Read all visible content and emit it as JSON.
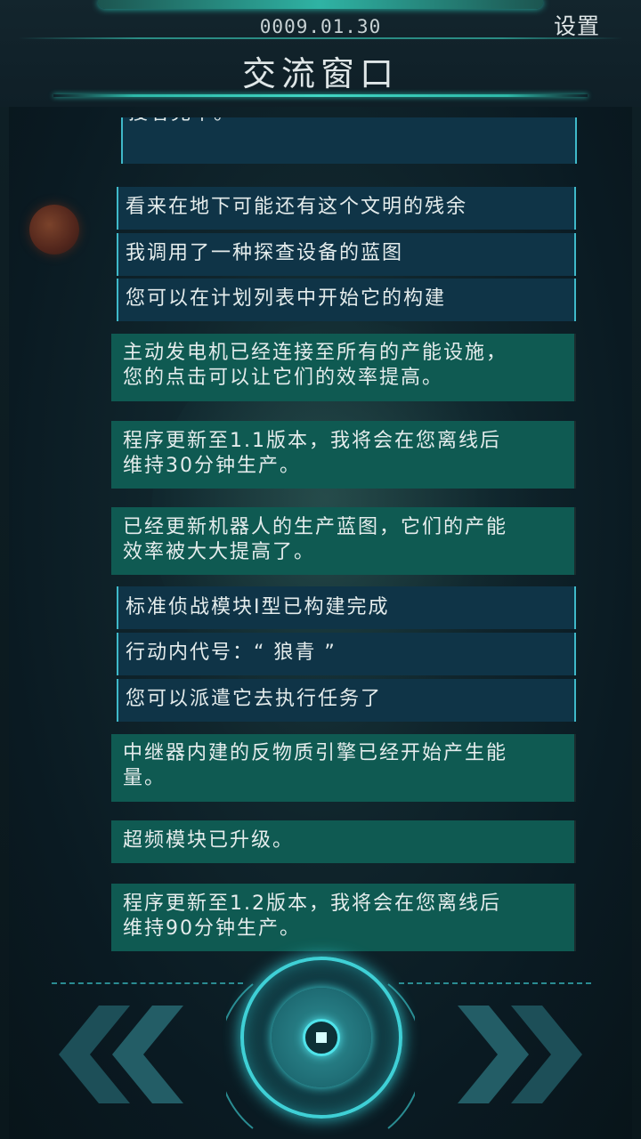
{
  "header": {
    "date": "0009.01.30",
    "settings_label": "设置",
    "title": "交流窗口"
  },
  "messages": [
    {
      "style": "blue",
      "lines": [
        "搜者完毕。"
      ]
    },
    {
      "style": "blue",
      "lines": [
        "看来在地下可能还有这个文明的残余"
      ]
    },
    {
      "style": "blue",
      "lines": [
        "我调用了一种探查设备的蓝图"
      ]
    },
    {
      "style": "blue",
      "lines": [
        "您可以在计划列表中开始它的构建"
      ]
    },
    {
      "style": "green",
      "lines": [
        "主动发电机已经连接至所有的产能设施，",
        "您的点击可以让它们的效率提高。"
      ]
    },
    {
      "style": "green",
      "lines": [
        "程序更新至1.1版本，我将会在您离线后",
        "维持30分钟生产。"
      ]
    },
    {
      "style": "green",
      "lines": [
        "已经更新机器人的生产蓝图，它们的产能",
        "效率被大大提高了。"
      ]
    },
    {
      "style": "blue",
      "lines": [
        "标准侦战模块I型已构建完成"
      ]
    },
    {
      "style": "blue",
      "lines": [
        "行动内代号：“ 狼青 ”"
      ]
    },
    {
      "style": "blue",
      "lines": [
        "您可以派遣它去执行任务了"
      ]
    },
    {
      "style": "green",
      "lines": [
        "中继器内建的反物质引擎已经开始产生能",
        "量。"
      ]
    },
    {
      "style": "green",
      "lines": [
        "超频模块已升级。"
      ]
    },
    {
      "style": "green",
      "lines": [
        "程序更新至1.2版本，我将会在您离线后",
        "维持90分钟生产。"
      ]
    }
  ],
  "controls": {
    "prev_icon": "double-chevron-left-icon",
    "next_icon": "double-chevron-right-icon",
    "center_icon": "core-button-icon"
  },
  "colors": {
    "accent": "#3fd0d6",
    "blue_panel": "#0f3447",
    "green_panel": "#0f5a52",
    "text": "#e4ecec"
  }
}
